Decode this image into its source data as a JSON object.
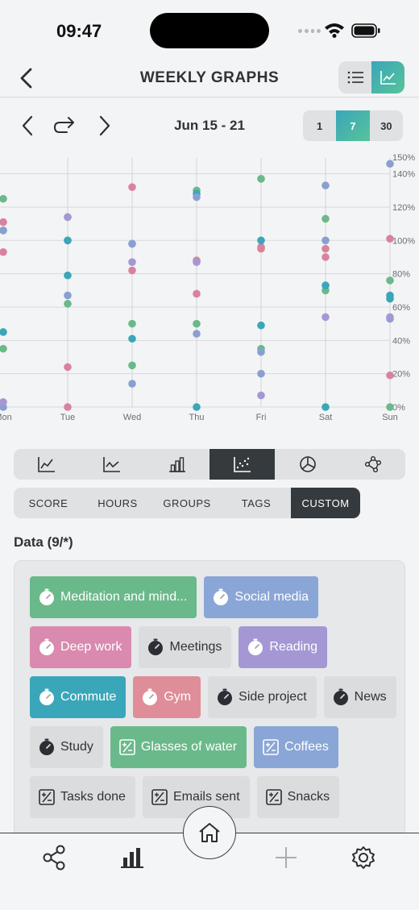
{
  "status": {
    "time": "09:47"
  },
  "nav": {
    "title": "WEEKLY GRAPHS"
  },
  "date_nav": {
    "range_label": "Jun 15 - 21",
    "ranges": [
      "1",
      "7",
      "30"
    ],
    "active_range": "7"
  },
  "chart_data": {
    "type": "scatter",
    "categories": [
      "Mon",
      "Tue",
      "Wed",
      "Thu",
      "Fri",
      "Sat",
      "Sun"
    ],
    "category_labels": [
      "Mon",
      "Tue",
      "Wed",
      "Thu",
      "Fri",
      "Sat",
      "Sun"
    ],
    "y_ticks": [
      "0%",
      "20%",
      "40%",
      "60%",
      "80%",
      "100%",
      "120%",
      "140%",
      "150%"
    ],
    "ylim": [
      0,
      150
    ],
    "grid": true,
    "series": [
      {
        "color": "#6ab98a",
        "values": [
          125,
          62,
          50,
          130,
          137,
          113,
          76
        ]
      },
      {
        "color": "#6ab98a",
        "values": [
          35,
          100,
          25,
          50,
          35,
          70,
          0
        ]
      },
      {
        "color": "#d9829e",
        "values": [
          111,
          24,
          132,
          88,
          96,
          95,
          101
        ]
      },
      {
        "color": "#d9829e",
        "values": [
          93,
          0,
          82,
          68,
          95,
          90,
          19
        ]
      },
      {
        "color": "#3aa6b9",
        "values": [
          45,
          79,
          41,
          0,
          49,
          73,
          65
        ]
      },
      {
        "color": "#3aa6b9",
        "values": [
          106,
          100,
          98,
          128,
          100,
          0,
          67
        ]
      },
      {
        "color": "#8a9fd1",
        "values": [
          106,
          67,
          14,
          126,
          20,
          133,
          146
        ]
      },
      {
        "color": "#8a9fd1",
        "values": [
          0,
          114,
          98,
          44,
          33,
          100,
          53
        ]
      },
      {
        "color": "#a597d4",
        "values": [
          3,
          114,
          87,
          87,
          7,
          54,
          54
        ]
      }
    ]
  },
  "chart_types": [
    {
      "icon": "line-chart-icon",
      "active": false
    },
    {
      "icon": "trend-chart-icon",
      "active": false
    },
    {
      "icon": "bar-chart-icon",
      "active": false
    },
    {
      "icon": "scatter-chart-icon",
      "active": true
    },
    {
      "icon": "pie-chart-icon",
      "active": false
    },
    {
      "icon": "network-chart-icon",
      "active": false
    }
  ],
  "metric_tabs": {
    "score": "SCORE",
    "hours": "HOURS",
    "groups": "GROUPS",
    "tags": "TAGS",
    "custom": "CUSTOM",
    "active": "CUSTOM"
  },
  "data_section": {
    "title": "Data (9/*)",
    "chips": [
      {
        "label": "Meditation and mind...",
        "icon": "stopwatch-icon",
        "color": "#6ab98a",
        "selected": true
      },
      {
        "label": "Social media",
        "icon": "stopwatch-icon",
        "color": "#8aa6d6",
        "selected": true
      },
      {
        "label": "Deep work",
        "icon": "stopwatch-icon",
        "color": "#d98aae",
        "selected": true
      },
      {
        "label": "Meetings",
        "icon": "stopwatch-icon",
        "color": "",
        "selected": false
      },
      {
        "label": "Reading",
        "icon": "stopwatch-icon",
        "color": "#a597d4",
        "selected": true
      },
      {
        "label": "Commute",
        "icon": "stopwatch-icon",
        "color": "#3aa6b9",
        "selected": true
      },
      {
        "label": "Gym",
        "icon": "stopwatch-icon",
        "color": "#df8d98",
        "selected": true
      },
      {
        "label": "Side project",
        "icon": "stopwatch-icon",
        "color": "",
        "selected": false
      },
      {
        "label": "News",
        "icon": "stopwatch-icon",
        "color": "",
        "selected": false
      },
      {
        "label": "Study",
        "icon": "stopwatch-icon",
        "color": "",
        "selected": false
      },
      {
        "label": "Glasses of water",
        "icon": "counter-icon",
        "color": "#6ab98a",
        "selected": true
      },
      {
        "label": "Coffees",
        "icon": "counter-icon",
        "color": "#8aa6d6",
        "selected": true
      },
      {
        "label": "Tasks done",
        "icon": "counter-icon",
        "color": "",
        "selected": false
      },
      {
        "label": "Emails sent",
        "icon": "counter-icon",
        "color": "",
        "selected": false
      },
      {
        "label": "Snacks",
        "icon": "counter-icon",
        "color": "",
        "selected": false
      }
    ]
  },
  "tab_bar": [
    {
      "icon": "share-icon"
    },
    {
      "icon": "stats-icon"
    },
    {
      "icon": "home-icon"
    },
    {
      "icon": "plus-icon"
    },
    {
      "icon": "settings-icon"
    }
  ]
}
